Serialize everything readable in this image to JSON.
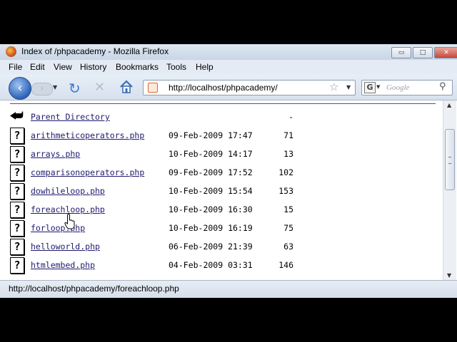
{
  "window": {
    "title": "Index of /phpacademy - Mozilla Firefox",
    "controls": {
      "minimize": "▭",
      "maximize": "□",
      "close": "✕"
    }
  },
  "menubar": {
    "items": [
      "File",
      "Edit",
      "View",
      "History",
      "Bookmarks",
      "Tools",
      "Help"
    ]
  },
  "navbar": {
    "url": "http://localhost/phpacademy/",
    "search_placeholder": "Google",
    "search_engine_glyph": "G"
  },
  "listing": {
    "parent": {
      "label": "Parent Directory",
      "size": "-"
    },
    "files": [
      {
        "name": "arithmeticoperators.php",
        "date": "09-Feb-2009 17:47",
        "size": "71"
      },
      {
        "name": "arrays.php",
        "date": "10-Feb-2009 14:17",
        "size": "13"
      },
      {
        "name": "comparisonoperators.php",
        "date": "09-Feb-2009 17:52",
        "size": "102"
      },
      {
        "name": "dowhileloop.php",
        "date": "10-Feb-2009 15:54",
        "size": "153"
      },
      {
        "name": "foreachloop.php",
        "date": "10-Feb-2009 16:30",
        "size": "15"
      },
      {
        "name": "forloop.php",
        "date": "10-Feb-2009 16:19",
        "size": "75"
      },
      {
        "name": "helloworld.php",
        "date": "06-Feb-2009 21:39",
        "size": "63"
      },
      {
        "name": "htmlembed.php",
        "date": "04-Feb-2009 03:31",
        "size": "146"
      }
    ],
    "file_icon_glyph": "?"
  },
  "status": {
    "text": "http://localhost/phpacademy/foreachloop.php"
  },
  "icons": {
    "back": "back-arrow-icon",
    "forward": "forward-arrow-icon",
    "reload": "reload-icon",
    "stop": "stop-icon",
    "home": "home-icon",
    "bookmark_star": "star-icon",
    "search": "magnifier-icon",
    "unknown_file": "unknown-file-icon",
    "parent_dir": "parent-directory-icon",
    "cursor": "hand-cursor-icon"
  },
  "colors": {
    "link": "#1f1a6e",
    "chrome": "#dfe7f1"
  }
}
